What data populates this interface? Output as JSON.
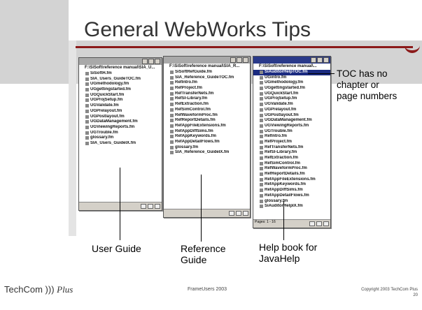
{
  "slide": {
    "title": "General WebWorks Tips",
    "footer_center": "FrameUsers 2003",
    "footer_copyright": "Copyright 2003 TechCom Plus",
    "page_number": "20",
    "logo_text": "TechCom",
    "logo_plus": "Plus"
  },
  "colors": {
    "accent_red": "#8b1a1a",
    "band_gray": "#d3d3d3",
    "active_titlebar": "#2a3a8a"
  },
  "windows": {
    "user_guide": {
      "path": "F:\\SiSoft\\reference manual\\SIA_U...",
      "items": [
        "SiSoftH.fm",
        "SIA_Users_GuideTOC.fm",
        "UGmethodology.fm",
        "UGgettingstarted.fm",
        "UGQuickStart.fm",
        "UGProjSetup.fm",
        "UGValidate.fm",
        "UGPrelayout.fm",
        "UGPostlayout.fm",
        "UGDataManagement.fm",
        "UGViewingReports.fm",
        "UGTrouble.fm",
        "glossary.fm",
        "SIA_Users_GuideIX.fm"
      ]
    },
    "reference_guide": {
      "path": "F:\\SiSoft\\reference manual\\SIA_R...",
      "items": [
        "SiSoftRefGuide.fm",
        "SIA_Reference_GuideTOC.fm",
        "RefIntro.fm",
        "RefProject.fm",
        "RefTransferNets.fm",
        "RefSI-Library.fm",
        "RefExtraction.fm",
        "RefSimControl.fm",
        "RefWaveformProc.fm",
        "RefReportDetails.fm",
        "RefAppFileExtensions.fm",
        "RefAppDiffSims.fm",
        "RefAppKeywords.fm",
        "RefAppDetailFlows.fm",
        "glossary.fm",
        "SIA_Reference_GuideIX.fm"
      ]
    },
    "help_book": {
      "path": "F:\\SiSoft\\reference manual\\...",
      "selected_item": "SiAuditorHelpTOC.fm",
      "items": [
        "SiAuditorHelpTOC.fm",
        "UGintro.fm",
        "UGmethodology.fm",
        "UGgettingstarted.fm",
        "UGQuickStart.fm",
        "UGProjSetup.fm",
        "UGValidate.fm",
        "UGPrelayout.fm",
        "UGPostlayout.fm",
        "UGDataManagement.fm",
        "UGViewingReports.fm",
        "UGTrouble.fm",
        "RefIntro.fm",
        "RefProject.fm",
        "RefTransferNets.fm",
        "RefSI-Library.fm",
        "RefExtraction.fm",
        "RefSimControl.fm",
        "RefWaveformProc.fm",
        "RefReportDetails.fm",
        "RefAppFileExtensions.fm",
        "RefAppKeywords.fm",
        "RefAppDiffSims.fm",
        "RefAppDetailFlows.fm",
        "glossary.fm",
        "SiAuditorHelpIX.fm"
      ],
      "status": "Pages: 1 - 16"
    }
  },
  "labels": {
    "user_guide": "User Guide",
    "reference_guide_line1": "Reference",
    "reference_guide_line2": "Guide",
    "help_book_line1": "Help book for",
    "help_book_line2": "JavaHelp",
    "toc_note_line1": "TOC has no",
    "toc_note_line2": "chapter or",
    "toc_note_line3": "page numbers"
  }
}
